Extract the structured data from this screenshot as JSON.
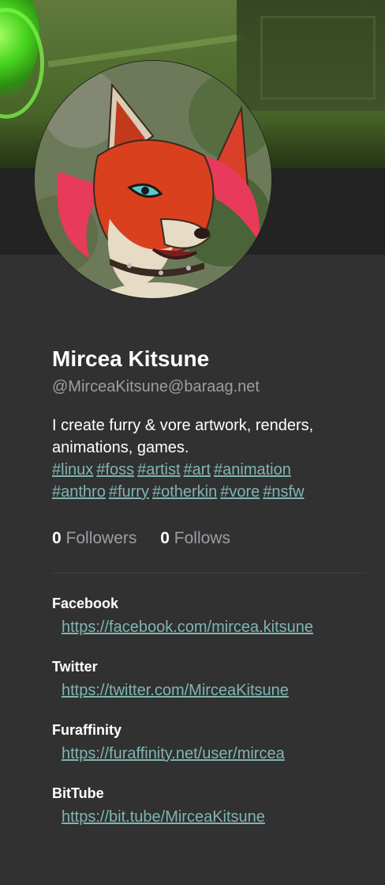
{
  "profile": {
    "display_name": "Mircea Kitsune",
    "account": "@MirceaKitsune@baraag.net",
    "bio": "I create furry & vore artwork, renders, animations, games.",
    "hashtags": [
      "#linux",
      "#foss",
      "#artist",
      "#art",
      "#animation",
      "#anthro",
      "#furry",
      "#otherkin",
      "#vore",
      "#nsfw"
    ]
  },
  "stats": {
    "followers_count": "0",
    "followers_label": "Followers",
    "follows_count": "0",
    "follows_label": "Follows"
  },
  "fields": [
    {
      "name": "Facebook",
      "value": "https://facebook.com/mircea.kitsune"
    },
    {
      "name": "Twitter",
      "value": "https://twitter.com/MirceaKitsune"
    },
    {
      "name": "Furaffinity",
      "value": "https://furaffinity.net/user/mircea"
    },
    {
      "name": "BitTube",
      "value": "https://bit.tube/MirceaKitsune"
    }
  ],
  "colors": {
    "background": "#313131",
    "link": "#7fb5b2",
    "muted": "#9a9ea4"
  }
}
